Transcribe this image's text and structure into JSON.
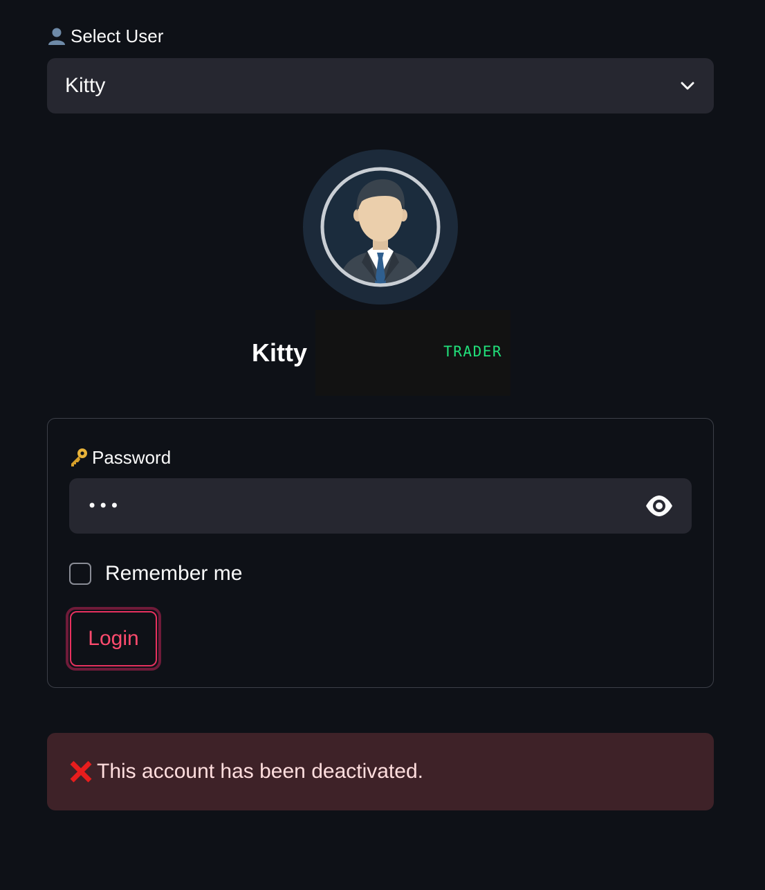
{
  "select_user": {
    "label": "Select User",
    "icon": "user-silhouette-icon",
    "selected_value": "Kitty"
  },
  "profile": {
    "name": "Kitty",
    "role": "TRADER",
    "avatar_icon": "businessman-avatar-icon"
  },
  "form": {
    "password_label": "Password",
    "password_icon": "key-icon",
    "password_value": "•••",
    "remember_label": "Remember me",
    "remember_checked": false,
    "login_label": "Login"
  },
  "alert": {
    "icon": "red-x-icon",
    "message": "This account has been deactivated."
  },
  "colors": {
    "background": "#0e1117",
    "input_bg": "#262730",
    "accent": "#ff4b6e",
    "role_green": "#21e07a",
    "alert_bg": "#3e2228"
  }
}
